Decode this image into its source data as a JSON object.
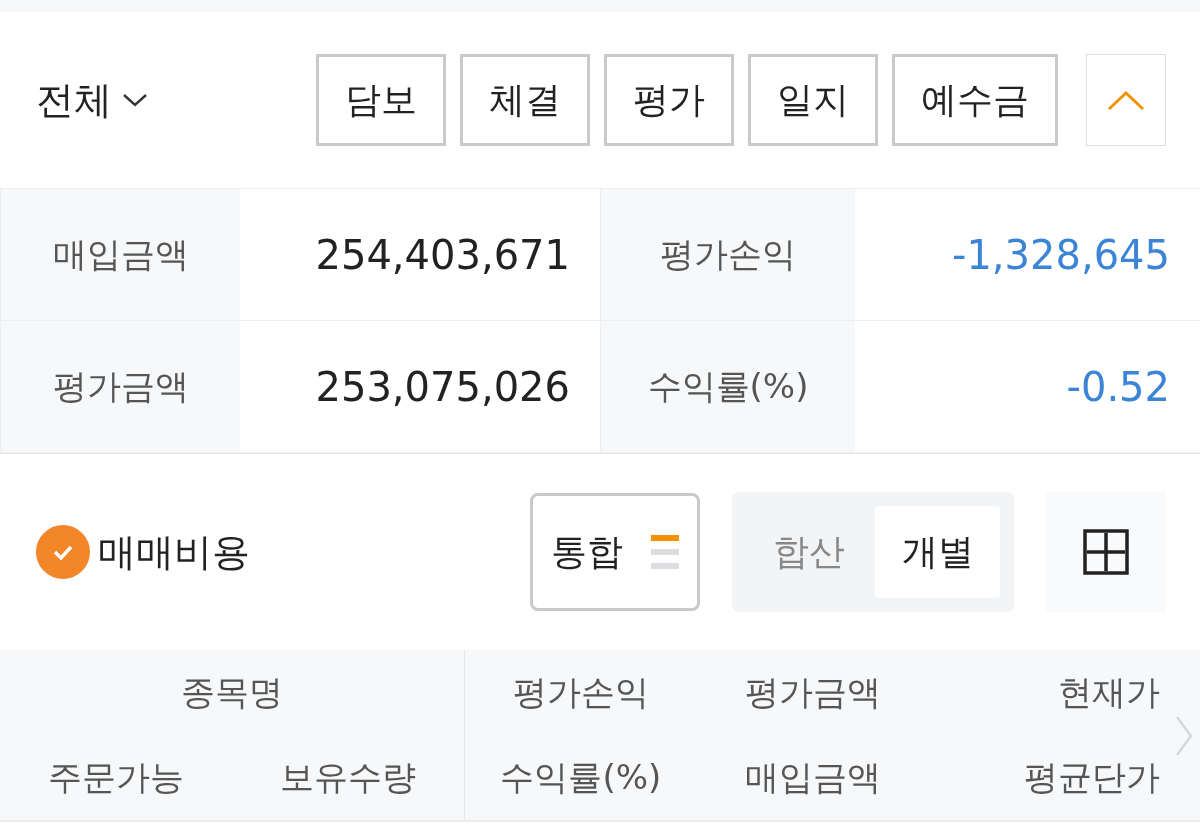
{
  "account_filter": {
    "label": "전체"
  },
  "tabs": [
    {
      "label": "담보"
    },
    {
      "label": "체결"
    },
    {
      "label": "평가"
    },
    {
      "label": "일지"
    },
    {
      "label": "예수금"
    }
  ],
  "collapse": {
    "expanded": true
  },
  "summary": [
    {
      "label": "매입금액",
      "value": "254,403,671",
      "color": "#222222"
    },
    {
      "label": "평가손익",
      "value": "-1,328,645",
      "color": "#3b84d6"
    },
    {
      "label": "평가금액",
      "value": "253,075,026",
      "color": "#222222"
    },
    {
      "label": "수익률(%)",
      "value": "-0.52",
      "color": "#3b84d6"
    }
  ],
  "trading_fee": {
    "label": "매매비용",
    "checked": true
  },
  "view_button": {
    "label": "통합"
  },
  "mode_toggle": [
    {
      "label": "합산",
      "selected": false
    },
    {
      "label": "개별",
      "selected": true
    }
  ],
  "table": {
    "left_header": {
      "title": "종목명",
      "sub": [
        "주문가능",
        "보유수량"
      ]
    },
    "columns": [
      {
        "top": "평가손익",
        "bottom": "수익률(%)"
      },
      {
        "top": "평가금액",
        "bottom": "매입금액"
      },
      {
        "top": "현재가",
        "bottom": "평균단가"
      }
    ]
  }
}
